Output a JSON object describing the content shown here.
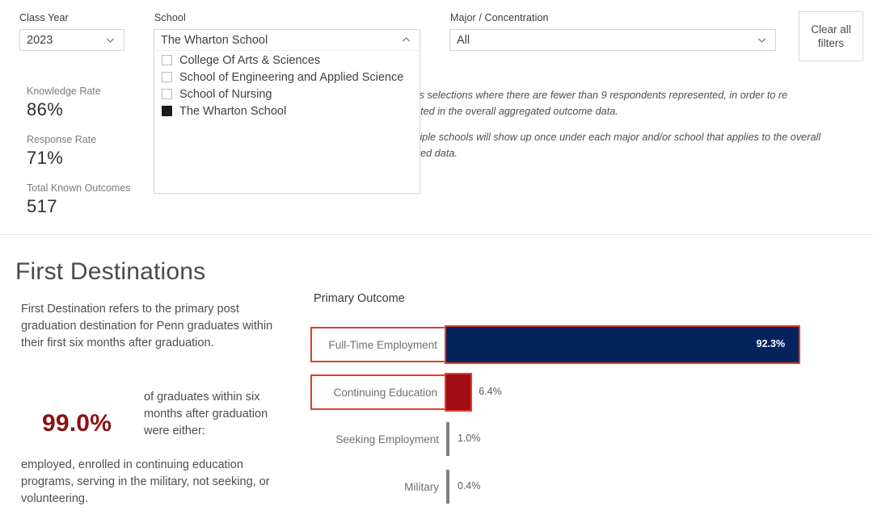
{
  "filters": {
    "class_year": {
      "label": "Class Year",
      "value": "2023"
    },
    "school": {
      "label": "School",
      "value": "The Wharton School",
      "options": [
        {
          "label": "College Of Arts & Sciences",
          "checked": false
        },
        {
          "label": "School of Engineering and Applied Science",
          "checked": false
        },
        {
          "label": "School of Nursing",
          "checked": false
        },
        {
          "label": "The Wharton School",
          "checked": true
        }
      ]
    },
    "major": {
      "label": "Major / Concentration",
      "value": "All"
    },
    "clear_button": {
      "line1": "Clear all",
      "line2": "filters"
    }
  },
  "metrics": [
    {
      "label": "Knowledge Rate",
      "value": "86%"
    },
    {
      "label": "Response Rate",
      "value": "71%"
    },
    {
      "label": "Total Known Outcomes",
      "value": "517"
    }
  ],
  "disclaimer": {
    "paragraph1": "s or cross selections where there are fewer than 9 respondents represented, in order to re represented in the overall aggregated outcome data.",
    "paragraph2": "rom multiple schools will show up once under each major and/or school that applies to the overall aggregated data."
  },
  "first_destinations": {
    "title": "First Destinations",
    "description": "First Destination refers to the primary post graduation destination for Penn graduates within their first six months after graduation.",
    "headline_value": "99.0%",
    "headline_text": "of graduates within six months after graduation were either:",
    "footer_text": "employed, enrolled in continuing education programs, serving in the military, not seeking, or volunteering."
  },
  "chart_data": {
    "type": "bar",
    "title": "Primary Outcome",
    "orientation": "horizontal",
    "xlabel": "",
    "ylabel": "",
    "xlim": [
      0,
      100
    ],
    "grid": false,
    "legend": null,
    "categories": [
      "Full-Time Employment",
      "Continuing Education",
      "Seeking Employment",
      "Military"
    ],
    "values": [
      92.3,
      6.4,
      1.0,
      0.4
    ],
    "value_labels": [
      "92.3%",
      "6.4%",
      "1.0%",
      "0.4%"
    ],
    "colors": [
      "#04235C",
      "#A00D12",
      "#808080",
      "#808080"
    ],
    "selected": [
      true,
      true,
      false,
      false
    ],
    "selection_color": "#E23D2B"
  }
}
